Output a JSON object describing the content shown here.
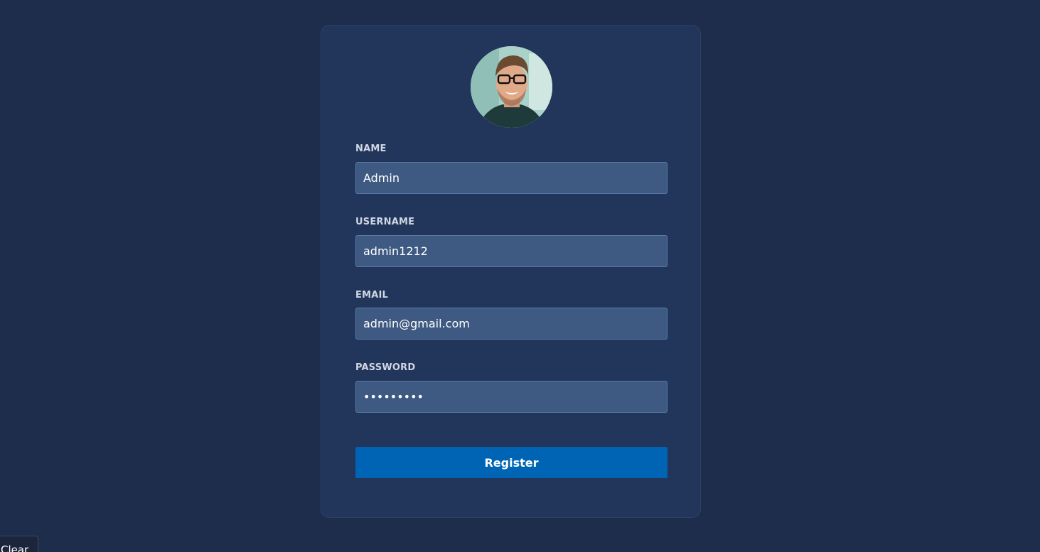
{
  "form": {
    "avatar_icon": "user-avatar-photo",
    "name_label": "NAME",
    "name_value": "Admin",
    "username_label": "USERNAME",
    "username_value": "admin1212",
    "email_label": "EMAIL",
    "email_value": "admin@gmail.com",
    "password_label": "PASSWORD",
    "password_value": "admin1212",
    "register_label": "Register"
  },
  "footer": {
    "clear_label": "Clear"
  },
  "colors": {
    "background": "#1e2d4b",
    "card": "#22355a",
    "input": "#3e5a82",
    "button": "#0064b5"
  }
}
